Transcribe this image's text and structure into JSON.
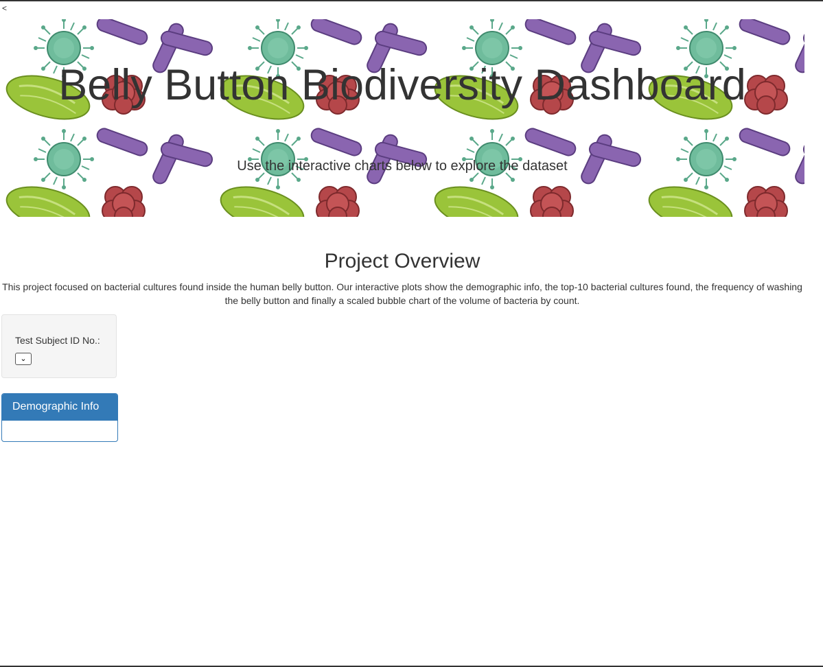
{
  "stray_text": "<",
  "banner": {
    "title": "Belly Button Biodiversity Dashboard",
    "subtitle": "Use the interactive charts below to explore the dataset"
  },
  "overview": {
    "title": "Project Overview",
    "text": "This project focused on bacterial cultures found inside the human belly button. Our interactive plots show the demographic info, the top-10 bacterial cultures found, the frequency of washing the belly button and finally a scaled bubble chart of the volume of bacteria by count."
  },
  "selector": {
    "label": "Test Subject ID No.:",
    "selected_value": "",
    "chevron": "⌄"
  },
  "demographic_panel": {
    "heading": "Demographic Info"
  },
  "colors": {
    "text": "#333333",
    "panel_primary": "#337ab7",
    "well_bg": "#f5f5f5",
    "virus": "#5aa88a",
    "rod_bacteria": "#8a65b0",
    "cluster_bacteria": "#b5474a",
    "green_bacteria": "#9ac43a"
  }
}
